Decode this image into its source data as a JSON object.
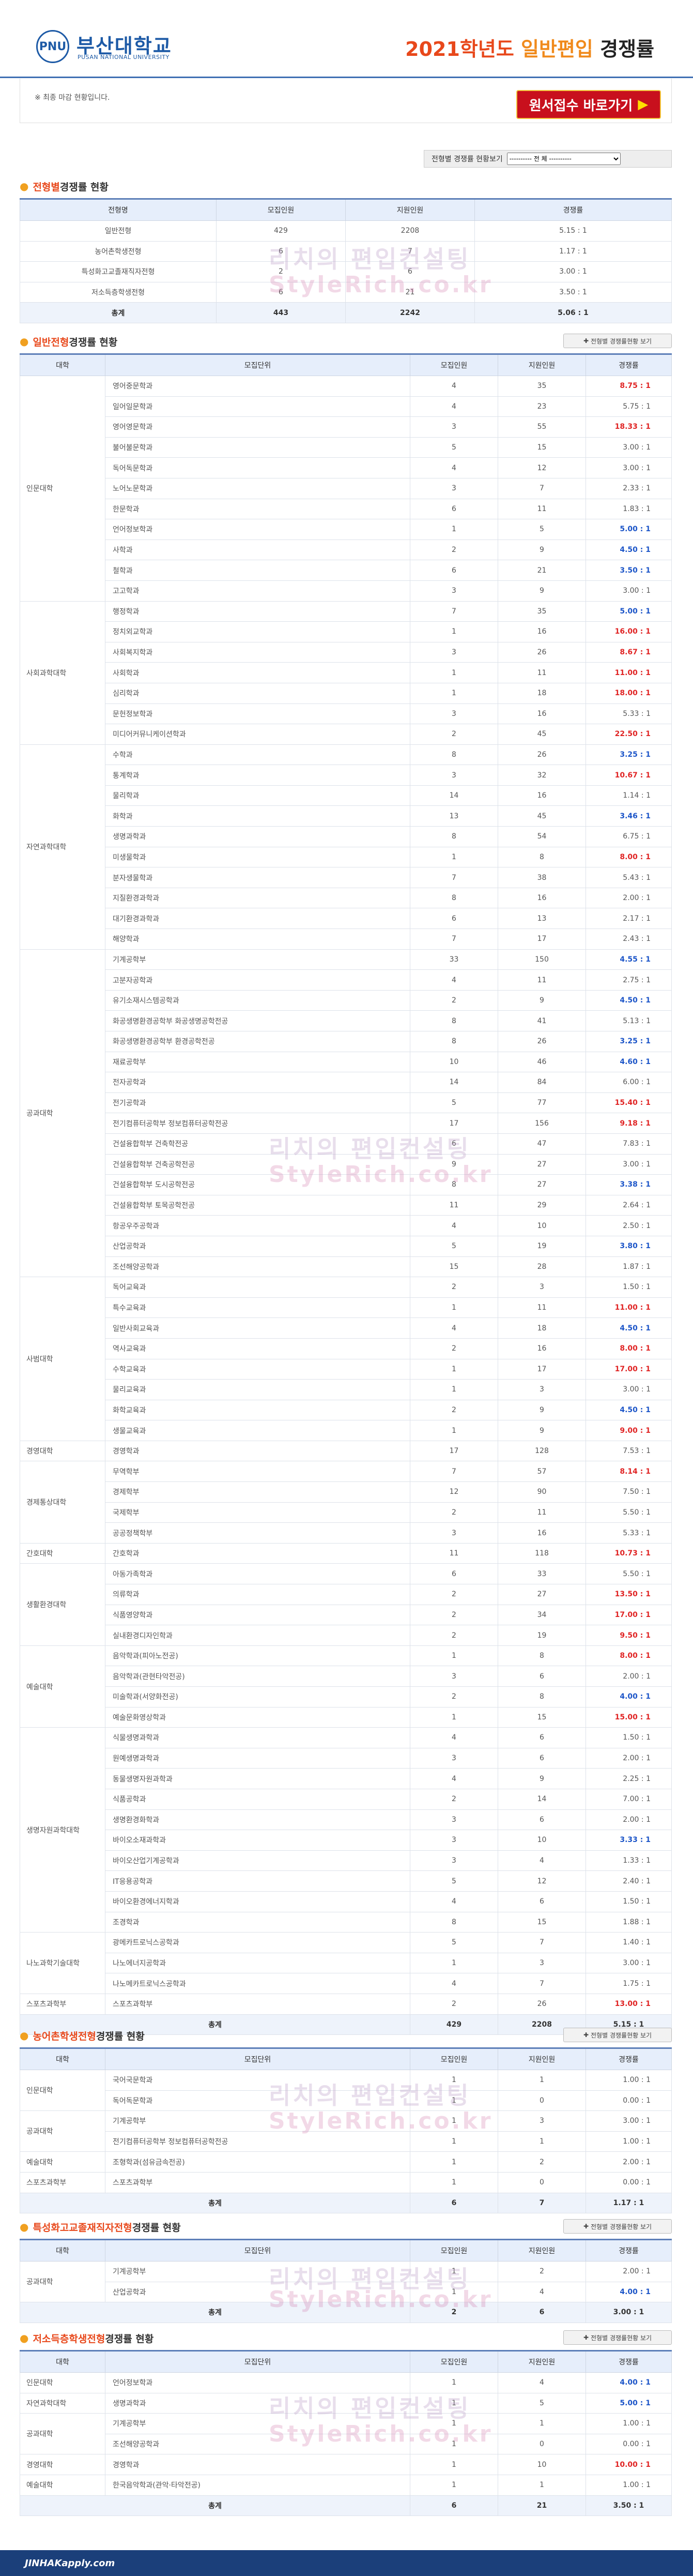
{
  "header": {
    "univ_ko": "부산대학교",
    "univ_en": "PUSAN NATIONAL UNIVERSITY",
    "title_year": "2021학년도",
    "title_type": "일반편입",
    "title_rest": " 경쟁률",
    "logo_mark": "PNU"
  },
  "notice": "※ 최종 마감 현황입니다.",
  "apply_label": "원서접수 바로가기",
  "apply_arrow": "▶",
  "selbar": {
    "label": "전형별 경쟁률 현황보기",
    "option": "---------- 전 체 ----------"
  },
  "wm_text": "리치의 편입컨설팅",
  "wm_text2": "StyleRich.co.kr",
  "summary": {
    "prefix": "전형별",
    "suffix": " 경쟁률 현황",
    "headers": [
      "전형명",
      "모집인원",
      "지원인원",
      "경쟁률"
    ],
    "rows": [
      [
        "일반전형",
        "429",
        "2208",
        "5.15 : 1"
      ],
      [
        "농어촌학생전형",
        "6",
        "7",
        "1.17 : 1"
      ],
      [
        "특성화고교졸재직자전형",
        "2",
        "6",
        "3.00 : 1"
      ],
      [
        "저소득층학생전형",
        "6",
        "21",
        "3.50 : 1"
      ],
      [
        "총계",
        "443",
        "2242",
        "5.06 : 1"
      ]
    ]
  },
  "general": {
    "prefix": "일반전형",
    "suffix": " 경쟁률 현황",
    "btn": "전형별 경쟁률현황 보기",
    "headers": [
      "대학",
      "모집단위",
      "모집인원",
      "지원인원",
      "경쟁률"
    ],
    "groups": [
      {
        "uni": "인문대학",
        "rows": [
          [
            "영어중문학과",
            "4",
            "35",
            "8.75 : 1"
          ],
          [
            "일어일문학과",
            "4",
            "23",
            "5.75 : 1"
          ],
          [
            "영어영문학과",
            "3",
            "55",
            "18.33 : 1"
          ],
          [
            "불어불문학과",
            "5",
            "15",
            "3.00 : 1"
          ],
          [
            "독어독문학과",
            "4",
            "12",
            "3.00 : 1"
          ],
          [
            "노어노문학과",
            "3",
            "7",
            "2.33 : 1"
          ],
          [
            "한문학과",
            "6",
            "11",
            "1.83 : 1"
          ],
          [
            "언어정보학과",
            "1",
            "5",
            "5.00 : 1"
          ],
          [
            "사학과",
            "2",
            "9",
            "4.50 : 1"
          ],
          [
            "철학과",
            "6",
            "21",
            "3.50 : 1"
          ],
          [
            "고고학과",
            "3",
            "9",
            "3.00 : 1"
          ]
        ]
      },
      {
        "uni": "사회과학대학",
        "rows": [
          [
            "행정학과",
            "7",
            "35",
            "5.00 : 1"
          ],
          [
            "정치외교학과",
            "1",
            "16",
            "16.00 : 1"
          ],
          [
            "사회복지학과",
            "3",
            "26",
            "8.67 : 1"
          ],
          [
            "사회학과",
            "1",
            "11",
            "11.00 : 1"
          ],
          [
            "심리학과",
            "1",
            "18",
            "18.00 : 1"
          ],
          [
            "문헌정보학과",
            "3",
            "16",
            "5.33 : 1"
          ],
          [
            "미디어커뮤니케이션학과",
            "2",
            "45",
            "22.50 : 1"
          ]
        ]
      },
      {
        "uni": "자연과학대학",
        "rows": [
          [
            "수학과",
            "8",
            "26",
            "3.25 : 1"
          ],
          [
            "통계학과",
            "3",
            "32",
            "10.67 : 1"
          ],
          [
            "물리학과",
            "14",
            "16",
            "1.14 : 1"
          ],
          [
            "화학과",
            "13",
            "45",
            "3.46 : 1"
          ],
          [
            "생명과학과",
            "8",
            "54",
            "6.75 : 1"
          ],
          [
            "미생물학과",
            "1",
            "8",
            "8.00 : 1"
          ],
          [
            "분자생물학과",
            "7",
            "38",
            "5.43 : 1"
          ],
          [
            "지질환경과학과",
            "8",
            "16",
            "2.00 : 1"
          ],
          [
            "대기환경과학과",
            "6",
            "13",
            "2.17 : 1"
          ],
          [
            "해양학과",
            "7",
            "17",
            "2.43 : 1"
          ]
        ]
      },
      {
        "uni": "공과대학",
        "rows": [
          [
            "기계공학부",
            "33",
            "150",
            "4.55 : 1"
          ],
          [
            "고분자공학과",
            "4",
            "11",
            "2.75 : 1"
          ],
          [
            "유기소재시스템공학과",
            "2",
            "9",
            "4.50 : 1"
          ],
          [
            "화공생명환경공학부 화공생명공학전공",
            "8",
            "41",
            "5.13 : 1"
          ],
          [
            "화공생명환경공학부 환경공학전공",
            "8",
            "26",
            "3.25 : 1"
          ],
          [
            "재료공학부",
            "10",
            "46",
            "4.60 : 1"
          ],
          [
            "전자공학과",
            "14",
            "84",
            "6.00 : 1"
          ],
          [
            "전기공학과",
            "5",
            "77",
            "15.40 : 1"
          ],
          [
            "전기컴퓨터공학부 정보컴퓨터공학전공",
            "17",
            "156",
            "9.18 : 1"
          ],
          [
            "건설융합학부 건축학전공",
            "6",
            "47",
            "7.83 : 1"
          ],
          [
            "건설융합학부 건축공학전공",
            "9",
            "27",
            "3.00 : 1"
          ],
          [
            "건설융합학부 도시공학전공",
            "8",
            "27",
            "3.38 : 1"
          ],
          [
            "건설융합학부 토목공학전공",
            "11",
            "29",
            "2.64 : 1"
          ],
          [
            "항공우주공학과",
            "4",
            "10",
            "2.50 : 1"
          ],
          [
            "산업공학과",
            "5",
            "19",
            "3.80 : 1"
          ],
          [
            "조선해양공학과",
            "15",
            "28",
            "1.87 : 1"
          ]
        ]
      },
      {
        "uni": "사범대학",
        "rows": [
          [
            "독어교육과",
            "2",
            "3",
            "1.50 : 1"
          ],
          [
            "특수교육과",
            "1",
            "11",
            "11.00 : 1"
          ],
          [
            "일반사회교육과",
            "4",
            "18",
            "4.50 : 1"
          ],
          [
            "역사교육과",
            "2",
            "16",
            "8.00 : 1"
          ],
          [
            "수학교육과",
            "1",
            "17",
            "17.00 : 1"
          ],
          [
            "물리교육과",
            "1",
            "3",
            "3.00 : 1"
          ],
          [
            "화학교육과",
            "2",
            "9",
            "4.50 : 1"
          ],
          [
            "생물교육과",
            "1",
            "9",
            "9.00 : 1"
          ]
        ]
      },
      {
        "uni": "경영대학",
        "rows": [
          [
            "경영학과",
            "17",
            "128",
            "7.53 : 1"
          ]
        ]
      },
      {
        "uni": "경제통상대학",
        "rows": [
          [
            "무역학부",
            "7",
            "57",
            "8.14 : 1"
          ],
          [
            "경제학부",
            "12",
            "90",
            "7.50 : 1"
          ],
          [
            "국제학부",
            "2",
            "11",
            "5.50 : 1"
          ],
          [
            "공공정책학부",
            "3",
            "16",
            "5.33 : 1"
          ]
        ]
      },
      {
        "uni": "간호대학",
        "rows": [
          [
            "간호학과",
            "11",
            "118",
            "10.73 : 1"
          ]
        ]
      },
      {
        "uni": "생활환경대학",
        "rows": [
          [
            "아동가족학과",
            "6",
            "33",
            "5.50 : 1"
          ],
          [
            "의류학과",
            "2",
            "27",
            "13.50 : 1"
          ],
          [
            "식품영양학과",
            "2",
            "34",
            "17.00 : 1"
          ],
          [
            "실내환경디자인학과",
            "2",
            "19",
            "9.50 : 1"
          ]
        ]
      },
      {
        "uni": "예술대학",
        "rows": [
          [
            "음악학과(피아노전공)",
            "1",
            "8",
            "8.00 : 1"
          ],
          [
            "음악학과(관현타악전공)",
            "3",
            "6",
            "2.00 : 1"
          ],
          [
            "미술학과(서양화전공)",
            "2",
            "8",
            "4.00 : 1"
          ],
          [
            "예술문화영상학과",
            "1",
            "15",
            "15.00 : 1"
          ]
        ]
      },
      {
        "uni": "생명자원과학대학",
        "rows": [
          [
            "식물생명과학과",
            "4",
            "6",
            "1.50 : 1"
          ],
          [
            "원예생명과학과",
            "3",
            "6",
            "2.00 : 1"
          ],
          [
            "동물생명자원과학과",
            "4",
            "9",
            "2.25 : 1"
          ],
          [
            "식품공학과",
            "2",
            "14",
            "7.00 : 1"
          ],
          [
            "생명환경화학과",
            "3",
            "6",
            "2.00 : 1"
          ],
          [
            "바이오소재과학과",
            "3",
            "10",
            "3.33 : 1"
          ],
          [
            "바이오산업기계공학과",
            "3",
            "4",
            "1.33 : 1"
          ],
          [
            "IT응용공학과",
            "5",
            "12",
            "2.40 : 1"
          ],
          [
            "바이오환경에너지학과",
            "4",
            "6",
            "1.50 : 1"
          ],
          [
            "조경학과",
            "8",
            "15",
            "1.88 : 1"
          ]
        ]
      },
      {
        "uni": "나노과학기술대학",
        "rows": [
          [
            "광메카트로닉스공학과",
            "5",
            "7",
            "1.40 : 1"
          ],
          [
            "나노에너지공학과",
            "1",
            "3",
            "3.00 : 1"
          ],
          [
            "나노메카트로닉스공학과",
            "4",
            "7",
            "1.75 : 1"
          ]
        ]
      },
      {
        "uni": "스포츠과학부",
        "rows": [
          [
            "스포츠과학부",
            "2",
            "26",
            "13.00 : 1"
          ]
        ]
      }
    ],
    "total": [
      "총계",
      "429",
      "2208",
      "5.15 : 1"
    ]
  },
  "rural": {
    "prefix": "농어촌학생전형",
    "suffix": " 경쟁률 현황",
    "btn": "전형별 경쟁률현황 보기",
    "headers": [
      "대학",
      "모집단위",
      "모집인원",
      "지원인원",
      "경쟁률"
    ],
    "groups": [
      {
        "uni": "인문대학",
        "rows": [
          [
            "국어국문학과",
            "1",
            "1",
            "1.00 : 1"
          ],
          [
            "독어독문학과",
            "1",
            "0",
            "0.00 : 1"
          ]
        ]
      },
      {
        "uni": "공과대학",
        "rows": [
          [
            "기계공학부",
            "1",
            "3",
            "3.00 : 1"
          ],
          [
            "전기컴퓨터공학부 정보컴퓨터공학전공",
            "1",
            "1",
            "1.00 : 1"
          ]
        ]
      },
      {
        "uni": "예술대학",
        "rows": [
          [
            "조형학과(섬유금속전공)",
            "1",
            "2",
            "2.00 : 1"
          ]
        ]
      },
      {
        "uni": "스포츠과학부",
        "rows": [
          [
            "스포츠과학부",
            "1",
            "0",
            "0.00 : 1"
          ]
        ]
      }
    ],
    "total": [
      "총계",
      "6",
      "7",
      "1.17 : 1"
    ]
  },
  "special": {
    "prefix": "특성화고교졸재직자전형",
    "suffix": " 경쟁률 현황",
    "btn": "전형별 경쟁률현황 보기",
    "headers": [
      "대학",
      "모집단위",
      "모집인원",
      "지원인원",
      "경쟁률"
    ],
    "groups": [
      {
        "uni": "공과대학",
        "rows": [
          [
            "기계공학부",
            "1",
            "2",
            "2.00 : 1"
          ],
          [
            "산업공학과",
            "1",
            "4",
            "4.00 : 1"
          ]
        ]
      }
    ],
    "total": [
      "총계",
      "2",
      "6",
      "3.00 : 1"
    ]
  },
  "lowincome": {
    "prefix": "저소득층학생전형",
    "suffix": " 경쟁률 현황",
    "btn": "전형별 경쟁률현황 보기",
    "headers": [
      "대학",
      "모집단위",
      "모집인원",
      "지원인원",
      "경쟁률"
    ],
    "groups": [
      {
        "uni": "인문대학",
        "rows": [
          [
            "언어정보학과",
            "1",
            "4",
            "4.00 : 1"
          ]
        ]
      },
      {
        "uni": "자연과학대학",
        "rows": [
          [
            "생명과학과",
            "1",
            "5",
            "5.00 : 1"
          ]
        ]
      },
      {
        "uni": "공과대학",
        "rows": [
          [
            "기계공학부",
            "1",
            "1",
            "1.00 : 1"
          ],
          [
            "조선해양공학과",
            "1",
            "0",
            "0.00 : 1"
          ]
        ]
      },
      {
        "uni": "경영대학",
        "rows": [
          [
            "경영학과",
            "1",
            "10",
            "10.00 : 1"
          ]
        ]
      },
      {
        "uni": "예술대학",
        "rows": [
          [
            "한국음악학과(관악·타악전공)",
            "1",
            "1",
            "1.00 : 1"
          ]
        ]
      }
    ],
    "total": [
      "총계",
      "6",
      "21",
      "3.50 : 1"
    ]
  },
  "footer": "JINHAKapply.com",
  "colors": {
    "accent_red": "#e02424",
    "accent_blue": "#1c55c8",
    "header_blue": "#3f6fb3"
  }
}
